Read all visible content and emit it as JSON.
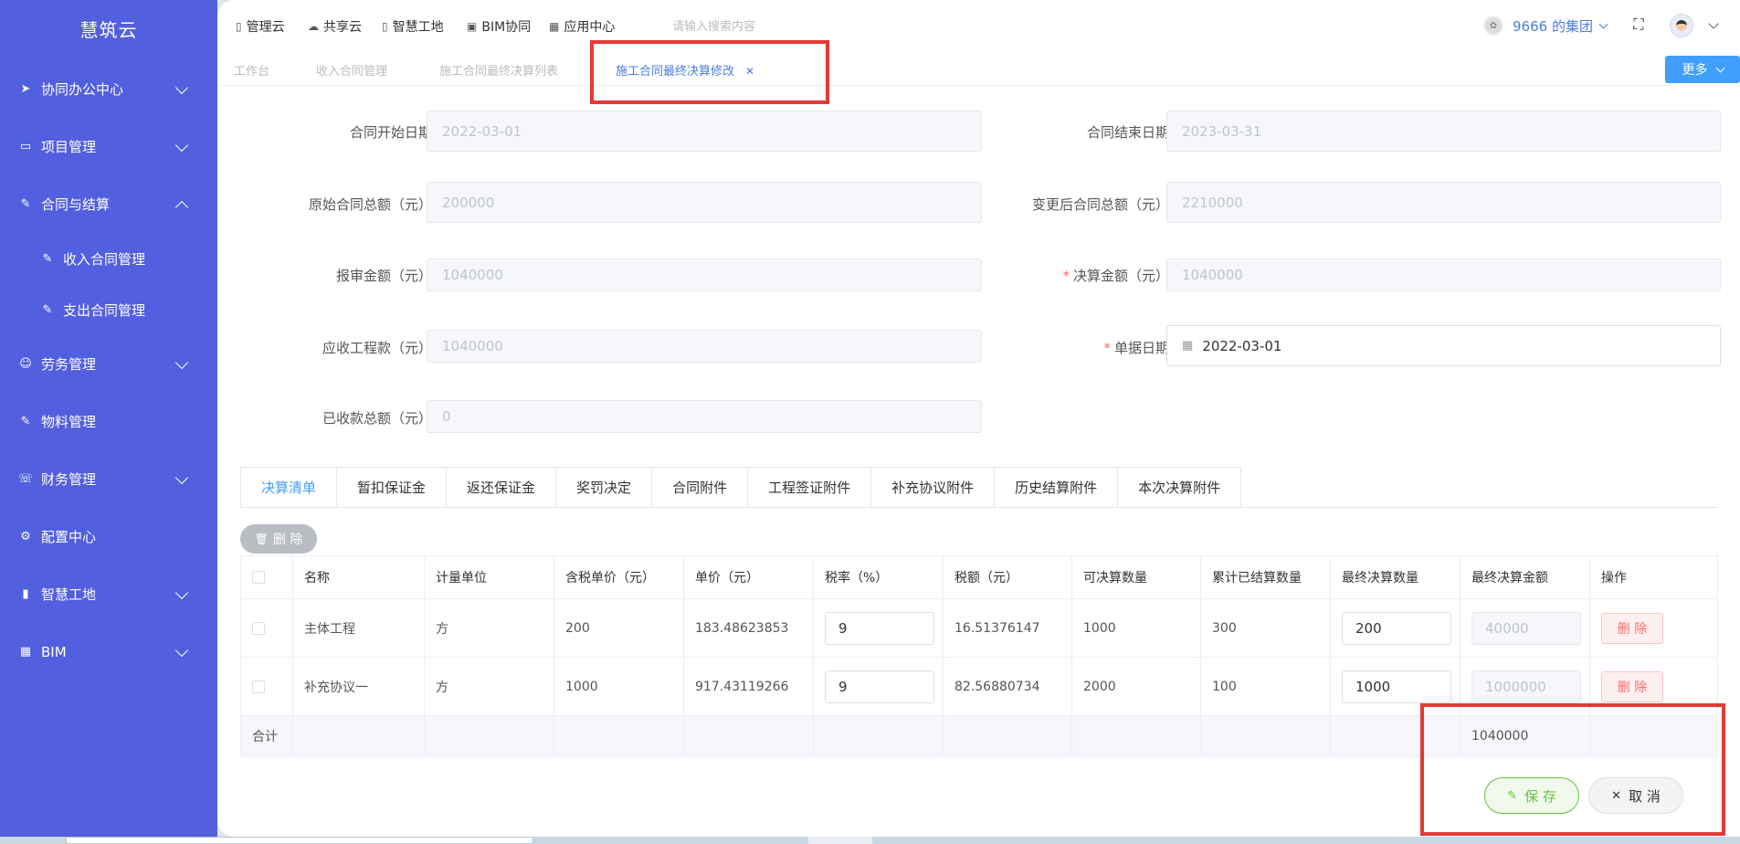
{
  "sidebar": {
    "brand": "慧筑云",
    "items": [
      {
        "label": "协同办公中心",
        "icon": "send-icon"
      },
      {
        "label": "项目管理",
        "icon": "book-icon"
      },
      {
        "label": "合同与结算",
        "icon": "edit-icon"
      },
      {
        "label": "劳务管理",
        "icon": "user-icon"
      },
      {
        "label": "物料管理",
        "icon": "edit-icon"
      },
      {
        "label": "财务管理",
        "icon": "phone-icon"
      },
      {
        "label": "配置中心",
        "icon": "gear-icon"
      },
      {
        "label": "智慧工地",
        "icon": "bar-chart-icon"
      },
      {
        "label": "BIM",
        "icon": "grid-icon"
      }
    ],
    "subitems": [
      {
        "label": "收入合同管理",
        "icon": "edit-icon"
      },
      {
        "label": "支出合同管理",
        "icon": "edit-icon"
      }
    ]
  },
  "topbar": {
    "links": [
      {
        "label": "管理云",
        "icon": "doc-icon"
      },
      {
        "label": "共享云",
        "icon": "cloud-icon"
      },
      {
        "label": "智慧工地",
        "icon": "doc-icon"
      },
      {
        "label": "BIM协同",
        "icon": "cube-icon"
      },
      {
        "label": "应用中心",
        "icon": "grid-icon"
      }
    ],
    "search_placeholder": "请输入搜索内容",
    "org": "9666 的集团"
  },
  "tabs": {
    "items": [
      "工作台",
      "收入合同管理",
      "施工合同最终决算列表",
      "施工合同最终决算修改"
    ],
    "more": "更多"
  },
  "form": {
    "start_date_label": "合同开始日期",
    "start_date": "2022-03-01",
    "end_date_label": "合同结束日期",
    "end_date": "2023-03-31",
    "orig_total_label": "原始合同总额（元）",
    "orig_total": "200000",
    "changed_total_label": "变更后合同总额（元）",
    "changed_total": "2210000",
    "review_label": "报审金额（元）",
    "review": "1040000",
    "settle_label": "决算金额（元）",
    "settle": "1040000",
    "receivable_label": "应收工程款（元）",
    "receivable": "1040000",
    "doc_date_label": "单据日期",
    "doc_date": "2022-03-01",
    "received_label": "已收款总额（元）",
    "received": "0"
  },
  "section_tabs": [
    "决算清单",
    "暂扣保证金",
    "返还保证金",
    "奖罚决定",
    "合同附件",
    "工程签证附件",
    "补充协议附件",
    "历史结算附件",
    "本次决算附件"
  ],
  "table": {
    "delete_label": "删 除",
    "headers": [
      "名称",
      "计量单位",
      "含税单价（元）",
      "单价（元）",
      "税率（%）",
      "税额（元）",
      "可决算数量",
      "累计已结算数量",
      "最终决算数量",
      "最终决算金额",
      "操作"
    ],
    "rows": [
      {
        "name": "主体工程",
        "unit": "方",
        "tax_price": "200",
        "price": "183.48623853",
        "tax_rate": "9",
        "tax": "16.51376147",
        "avail": "1000",
        "settled": "300",
        "final_qty": "200",
        "final_amt": "40000",
        "op": "删 除"
      },
      {
        "name": "补充协议一",
        "unit": "方",
        "tax_price": "1000",
        "price": "917.43119266",
        "tax_rate": "9",
        "tax": "82.56880734",
        "avail": "2000",
        "settled": "100",
        "final_qty": "1000",
        "final_amt": "1000000",
        "op": "删 除"
      }
    ],
    "sum_label": "合计",
    "sum_value": "1040000"
  },
  "footer": {
    "save": "保 存",
    "cancel": "取 消"
  }
}
